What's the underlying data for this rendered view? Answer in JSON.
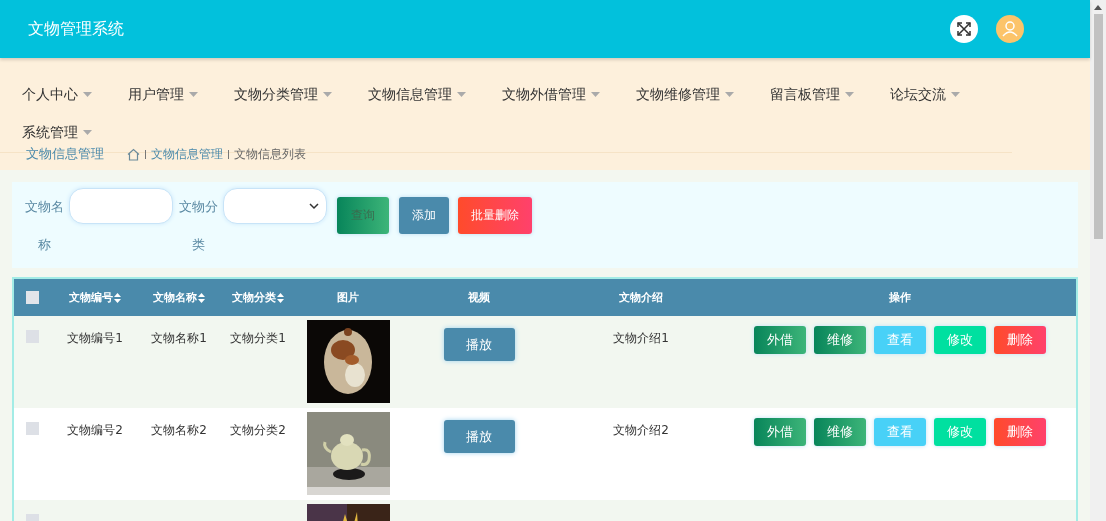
{
  "header": {
    "title": "文物管理系统"
  },
  "nav": [
    {
      "label": "个人中心"
    },
    {
      "label": "用户管理"
    },
    {
      "label": "文物分类管理"
    },
    {
      "label": "文物信息管理"
    },
    {
      "label": "文物外借管理"
    },
    {
      "label": "文物维修管理"
    },
    {
      "label": "留言板管理"
    },
    {
      "label": "论坛交流"
    },
    {
      "label": "系统管理"
    }
  ],
  "breadcrumb": {
    "title": "文物信息管理",
    "items": [
      "文物信息管理",
      "文物信息列表"
    ]
  },
  "search": {
    "fields": [
      {
        "kind": "text",
        "label": "文物名称"
      },
      {
        "kind": "select",
        "label": "文物分类"
      }
    ],
    "buttons": [
      {
        "kind": "query",
        "label": "查询"
      },
      {
        "kind": "add",
        "label": "添加"
      },
      {
        "kind": "delete",
        "label": "批量删除"
      }
    ]
  },
  "table": {
    "all_checked": false,
    "columns": [
      {
        "label": "文物编号",
        "sortable": true
      },
      {
        "label": "文物名称",
        "sortable": true
      },
      {
        "label": "文物分类",
        "sortable": true
      },
      {
        "label": "图片",
        "sortable": false
      },
      {
        "label": "视频",
        "sortable": false
      },
      {
        "label": "文物介绍",
        "sortable": false
      },
      {
        "label": "操作",
        "sortable": false
      }
    ],
    "rows": [
      {
        "checked": false,
        "code": "文物编号1",
        "name": "文物名称1",
        "category": "文物分类1",
        "play": "播放",
        "intro": "文物介绍1",
        "actions": [
          {
            "kind": "lend",
            "label": "外借"
          },
          {
            "kind": "repair",
            "label": "维修"
          },
          {
            "kind": "view",
            "label": "查看"
          },
          {
            "kind": "edit",
            "label": "修改"
          },
          {
            "kind": "delete",
            "label": "删除"
          }
        ]
      },
      {
        "checked": false,
        "code": "文物编号2",
        "name": "文物名称2",
        "category": "文物分类2",
        "play": "播放",
        "intro": "文物介绍2",
        "actions": [
          {
            "kind": "lend",
            "label": "外借"
          },
          {
            "kind": "repair",
            "label": "维修"
          },
          {
            "kind": "view",
            "label": "查看"
          },
          {
            "kind": "edit",
            "label": "修改"
          },
          {
            "kind": "delete",
            "label": "删除"
          }
        ]
      },
      {
        "checked": false
      }
    ]
  }
}
